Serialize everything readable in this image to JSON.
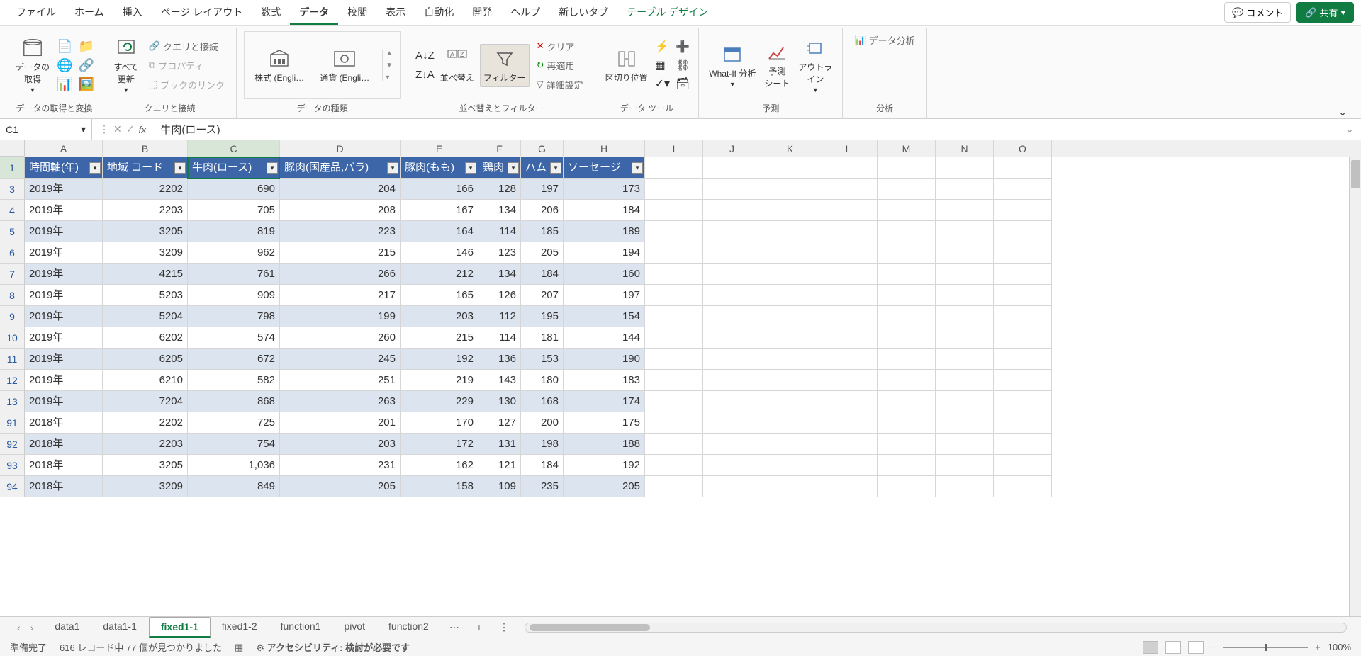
{
  "menu": {
    "items": [
      "ファイル",
      "ホーム",
      "挿入",
      "ページ レイアウト",
      "数式",
      "データ",
      "校閲",
      "表示",
      "自動化",
      "開発",
      "ヘルプ",
      "新しいタブ",
      "テーブル デザイン"
    ],
    "active": "データ",
    "comment_label": "コメント",
    "share_label": "共有"
  },
  "ribbon": {
    "groups": {
      "get_data": {
        "label": "データの取得と変換",
        "btn": "データの\n取得"
      },
      "queries": {
        "label": "クエリと接続",
        "refresh": "すべて\n更新",
        "q": "クエリと接続",
        "p": "プロパティ",
        "l": "ブックのリンク"
      },
      "types": {
        "label": "データの種類",
        "stock": "株式 (Engli…",
        "currency": "通貨 (Engli…"
      },
      "sort": {
        "label": "並べ替えとフィルター",
        "sort": "並べ替え",
        "filter": "フィルター",
        "clear": "クリア",
        "reapply": "再適用",
        "adv": "詳細設定"
      },
      "tools": {
        "label": "データ ツール",
        "split": "区切り位置"
      },
      "forecast": {
        "label": "予測",
        "whatif": "What-If 分析",
        "sheet": "予測\nシート",
        "outline": "アウトラ\nイン"
      },
      "analysis": {
        "label": "分析",
        "btn": "データ分析"
      }
    }
  },
  "formula": {
    "cell_ref": "C1",
    "value": "牛肉(ロース)"
  },
  "columns": {
    "letters": [
      "A",
      "B",
      "C",
      "D",
      "E",
      "F",
      "G",
      "H",
      "I",
      "J",
      "K",
      "L",
      "M",
      "N",
      "O"
    ],
    "widths": [
      110,
      120,
      130,
      170,
      110,
      60,
      60,
      115,
      82,
      82,
      82,
      82,
      82,
      82,
      82
    ],
    "headers": [
      "時間軸(年)",
      "地域 コード",
      "牛肉(ロース)",
      "豚肉(国産品,バラ)",
      "豚肉(もも)",
      "鶏肉",
      "ハム",
      "ソーセージ"
    ]
  },
  "rows": [
    {
      "n": 3,
      "d": [
        "2019年",
        "2202",
        "690",
        "204",
        "166",
        "128",
        "197",
        "173"
      ]
    },
    {
      "n": 4,
      "d": [
        "2019年",
        "2203",
        "705",
        "208",
        "167",
        "134",
        "206",
        "184"
      ]
    },
    {
      "n": 5,
      "d": [
        "2019年",
        "3205",
        "819",
        "223",
        "164",
        "114",
        "185",
        "189"
      ]
    },
    {
      "n": 6,
      "d": [
        "2019年",
        "3209",
        "962",
        "215",
        "146",
        "123",
        "205",
        "194"
      ]
    },
    {
      "n": 7,
      "d": [
        "2019年",
        "4215",
        "761",
        "266",
        "212",
        "134",
        "184",
        "160"
      ]
    },
    {
      "n": 8,
      "d": [
        "2019年",
        "5203",
        "909",
        "217",
        "165",
        "126",
        "207",
        "197"
      ]
    },
    {
      "n": 9,
      "d": [
        "2019年",
        "5204",
        "798",
        "199",
        "203",
        "112",
        "195",
        "154"
      ]
    },
    {
      "n": 10,
      "d": [
        "2019年",
        "6202",
        "574",
        "260",
        "215",
        "114",
        "181",
        "144"
      ]
    },
    {
      "n": 11,
      "d": [
        "2019年",
        "6205",
        "672",
        "245",
        "192",
        "136",
        "153",
        "190"
      ]
    },
    {
      "n": 12,
      "d": [
        "2019年",
        "6210",
        "582",
        "251",
        "219",
        "143",
        "180",
        "183"
      ]
    },
    {
      "n": 13,
      "d": [
        "2019年",
        "7204",
        "868",
        "263",
        "229",
        "130",
        "168",
        "174"
      ]
    },
    {
      "n": 91,
      "d": [
        "2018年",
        "2202",
        "725",
        "201",
        "170",
        "127",
        "200",
        "175"
      ]
    },
    {
      "n": 92,
      "d": [
        "2018年",
        "2203",
        "754",
        "203",
        "172",
        "131",
        "198",
        "188"
      ]
    },
    {
      "n": 93,
      "d": [
        "2018年",
        "3205",
        "1,036",
        "231",
        "162",
        "121",
        "184",
        "192"
      ]
    },
    {
      "n": 94,
      "d": [
        "2018年",
        "3209",
        "849",
        "205",
        "158",
        "109",
        "235",
        "205"
      ]
    }
  ],
  "sheets": {
    "tabs": [
      "data1",
      "data1-1",
      "fixed1-1",
      "fixed1-2",
      "function1",
      "pivot",
      "function2"
    ],
    "active": "fixed1-1"
  },
  "status": {
    "ready": "準備完了",
    "records": "616 レコード中 77 個が見つかりました",
    "a11y": "アクセシビリティ: 検討が必要です",
    "zoom": "100%"
  }
}
